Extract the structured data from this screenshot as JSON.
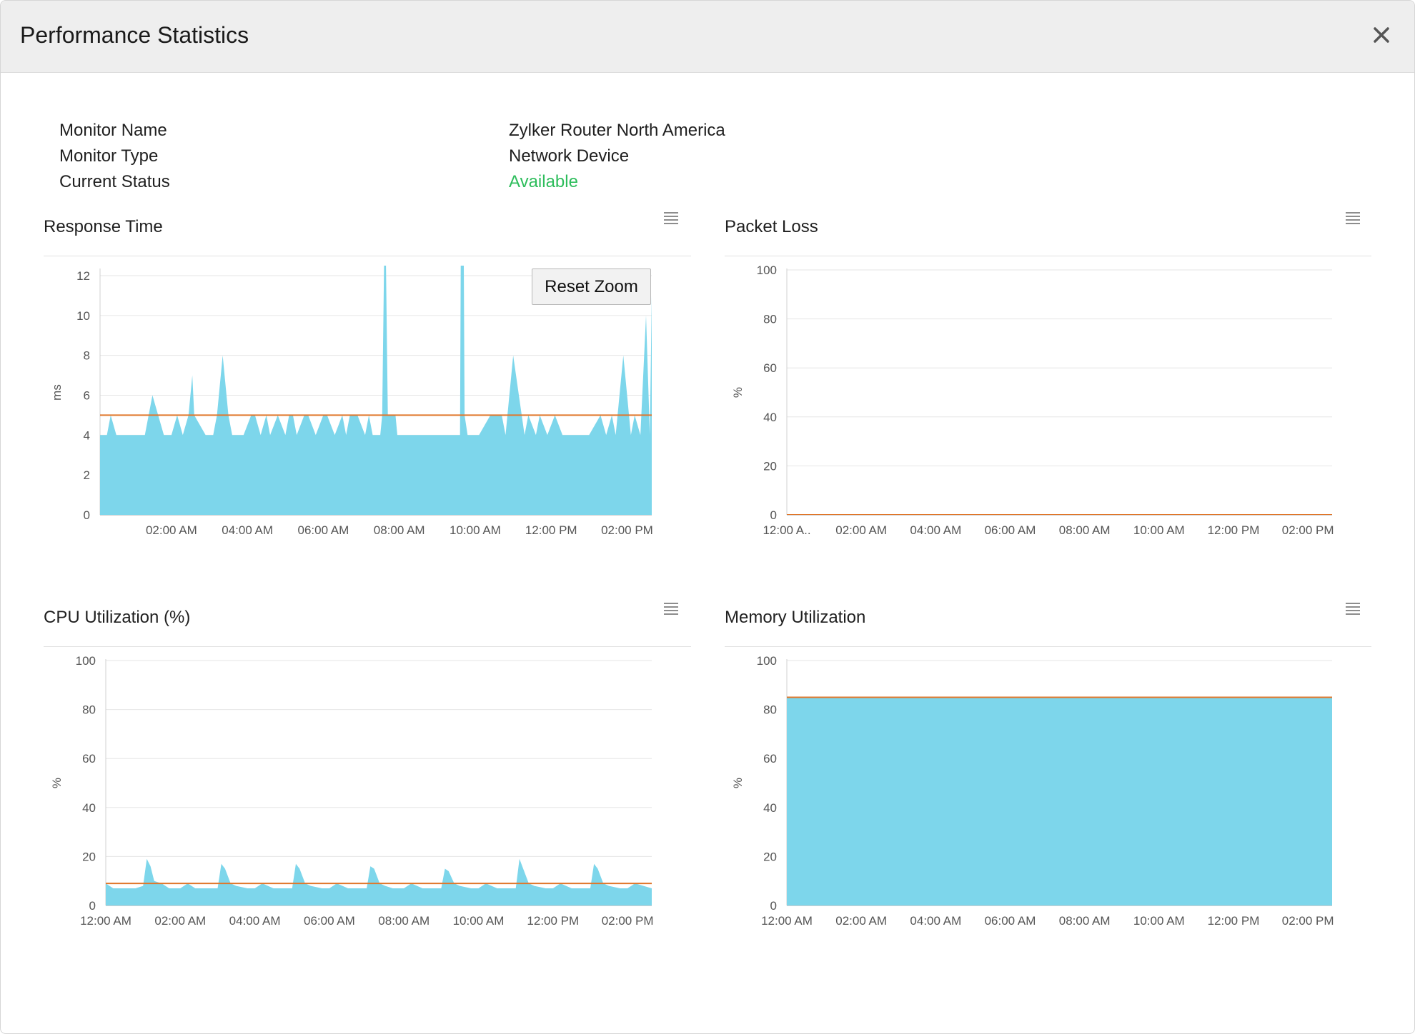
{
  "dialog": {
    "title": "Performance Statistics",
    "close_icon": "close-icon"
  },
  "info": {
    "rows": [
      {
        "label": "Monitor Name",
        "value": "Zylker Router North America"
      },
      {
        "label": "Monitor Type",
        "value": "Network Device"
      },
      {
        "label": "Current Status",
        "value": "Available"
      }
    ],
    "status_color": "#2ebd5c"
  },
  "colors": {
    "area_fill": "#7dd6eb",
    "threshold_line": "#e0772b",
    "grid": "#e6e6e6"
  },
  "reset_zoom_label": "Reset Zoom",
  "chart_data": [
    {
      "id": "response-time",
      "type": "area",
      "title": "Response Time",
      "xlabel": "",
      "ylabel": "ms",
      "ylim": [
        0,
        12
      ],
      "y_ticks": [
        "0",
        "2",
        "4",
        "6",
        "8",
        "10",
        "12"
      ],
      "x_ticks": [
        "02:00 AM",
        "04:00 AM",
        "06:00 AM",
        "08:00 AM",
        "10:00 AM",
        "12:00 PM",
        "02:00 PM"
      ],
      "x_tick_hours": [
        2,
        4,
        6,
        8,
        10,
        12,
        14
      ],
      "xlim_hours": [
        0.12,
        14.65
      ],
      "grid": true,
      "threshold": 5,
      "series": [
        {
          "name": "Response Time",
          "x": [
            0.12,
            0.3,
            0.4,
            0.55,
            1.1,
            1.3,
            1.4,
            1.5,
            1.8,
            2.0,
            2.15,
            2.3,
            2.45,
            2.55,
            2.6,
            2.9,
            3.1,
            3.2,
            3.35,
            3.5,
            3.6,
            3.7,
            3.9,
            4.1,
            4.2,
            4.35,
            4.5,
            4.6,
            4.8,
            5.0,
            5.1,
            5.2,
            5.3,
            5.5,
            5.6,
            5.8,
            6.0,
            6.1,
            6.3,
            6.5,
            6.6,
            6.7,
            6.9,
            7.1,
            7.2,
            7.3,
            7.5,
            7.55,
            7.6,
            7.65,
            7.7,
            7.9,
            7.95,
            8.3,
            9.5,
            9.6,
            9.62,
            9.7,
            9.72,
            9.8,
            10.1,
            10.4,
            10.7,
            10.8,
            11.0,
            11.3,
            11.4,
            11.6,
            11.7,
            11.9,
            12.1,
            12.3,
            13.0,
            13.3,
            13.45,
            13.6,
            13.7,
            13.9,
            14.1,
            14.2,
            14.35,
            14.5,
            14.6,
            14.65
          ],
          "y": [
            4,
            4,
            5,
            4,
            4,
            4,
            5,
            6,
            4,
            4,
            5,
            4,
            5,
            7,
            5,
            4,
            4,
            5,
            8,
            5,
            4,
            4,
            4,
            5,
            5,
            4,
            5,
            4,
            5,
            4,
            5,
            5,
            4,
            5,
            5,
            4,
            5,
            5,
            4,
            5,
            4,
            5,
            5,
            4,
            5,
            4,
            4,
            5,
            12.5,
            12.5,
            5,
            5,
            4,
            4,
            4,
            4,
            12.5,
            12.5,
            5,
            4,
            4,
            5,
            5,
            4,
            8,
            4,
            5,
            4,
            5,
            4,
            5,
            4,
            4,
            5,
            4,
            5,
            4,
            8,
            4,
            5,
            4,
            10,
            4,
            11
          ]
        }
      ]
    },
    {
      "id": "packet-loss",
      "type": "area",
      "title": "Packet Loss",
      "xlabel": "",
      "ylabel": "%",
      "ylim": [
        0,
        100
      ],
      "y_ticks": [
        "0",
        "20",
        "40",
        "60",
        "80",
        "100"
      ],
      "x_ticks": [
        "12:00 A..",
        "02:00 AM",
        "04:00 AM",
        "06:00 AM",
        "08:00 AM",
        "10:00 AM",
        "12:00 PM",
        "02:00 PM"
      ],
      "x_tick_hours": [
        0,
        2,
        4,
        6,
        8,
        10,
        12,
        14
      ],
      "xlim_hours": [
        0,
        14.65
      ],
      "grid": true,
      "threshold": 0,
      "series": [
        {
          "name": "Packet Loss",
          "x": [
            0,
            14.65
          ],
          "y": [
            0,
            0
          ]
        }
      ]
    },
    {
      "id": "cpu-utilization",
      "type": "area",
      "title": "CPU Utilization (%)",
      "xlabel": "",
      "ylabel": "%",
      "ylim": [
        0,
        100
      ],
      "y_ticks": [
        "0",
        "20",
        "40",
        "60",
        "80",
        "100"
      ],
      "x_ticks": [
        "12:00 AM",
        "02:00 AM",
        "04:00 AM",
        "06:00 AM",
        "08:00 AM",
        "10:00 AM",
        "12:00 PM",
        "02:00 PM"
      ],
      "x_tick_hours": [
        0,
        2,
        4,
        6,
        8,
        10,
        12,
        14
      ],
      "xlim_hours": [
        0,
        14.65
      ],
      "grid": true,
      "threshold": 9,
      "series": [
        {
          "name": "CPU Utilization",
          "x": [
            0,
            0.2,
            0.4,
            0.8,
            1.0,
            1.1,
            1.2,
            1.3,
            1.5,
            1.7,
            2.0,
            2.2,
            2.4,
            2.6,
            3.0,
            3.1,
            3.2,
            3.35,
            3.5,
            3.8,
            4.0,
            4.2,
            4.5,
            4.8,
            5.0,
            5.1,
            5.2,
            5.35,
            5.5,
            5.8,
            6.0,
            6.2,
            6.5,
            6.8,
            7.0,
            7.1,
            7.2,
            7.35,
            7.5,
            7.7,
            8.0,
            8.2,
            8.5,
            8.8,
            9.0,
            9.1,
            9.2,
            9.35,
            9.5,
            9.8,
            10.0,
            10.2,
            10.5,
            10.8,
            11.0,
            11.1,
            11.2,
            11.35,
            11.5,
            11.8,
            12.0,
            12.2,
            12.5,
            12.8,
            13.0,
            13.1,
            13.2,
            13.35,
            13.5,
            13.8,
            14.0,
            14.2,
            14.65
          ],
          "y": [
            9,
            7,
            7,
            7,
            8,
            19,
            16,
            10,
            9,
            7,
            7,
            9,
            7,
            7,
            7,
            17,
            15,
            9,
            8,
            7,
            7,
            9,
            7,
            7,
            7,
            17,
            15,
            9,
            8,
            7,
            7,
            9,
            7,
            7,
            7,
            16,
            15,
            9,
            8,
            7,
            7,
            9,
            7,
            7,
            7,
            15,
            14,
            9,
            8,
            7,
            7,
            9,
            7,
            7,
            7,
            19,
            15,
            9,
            8,
            7,
            7,
            9,
            7,
            7,
            7,
            17,
            15,
            9,
            8,
            7,
            7,
            9,
            7
          ]
        }
      ]
    },
    {
      "id": "memory-utilization",
      "type": "area",
      "title": "Memory Utilization",
      "xlabel": "",
      "ylabel": "%",
      "ylim": [
        0,
        100
      ],
      "y_ticks": [
        "0",
        "20",
        "40",
        "60",
        "80",
        "100"
      ],
      "x_ticks": [
        "12:00 AM",
        "02:00 AM",
        "04:00 AM",
        "06:00 AM",
        "08:00 AM",
        "10:00 AM",
        "12:00 PM",
        "02:00 PM"
      ],
      "x_tick_hours": [
        0,
        2,
        4,
        6,
        8,
        10,
        12,
        14
      ],
      "xlim_hours": [
        0,
        14.65
      ],
      "grid": true,
      "threshold": 85,
      "series": [
        {
          "name": "Memory Utilization",
          "x": [
            0,
            14.65
          ],
          "y": [
            85,
            85
          ]
        }
      ]
    }
  ]
}
